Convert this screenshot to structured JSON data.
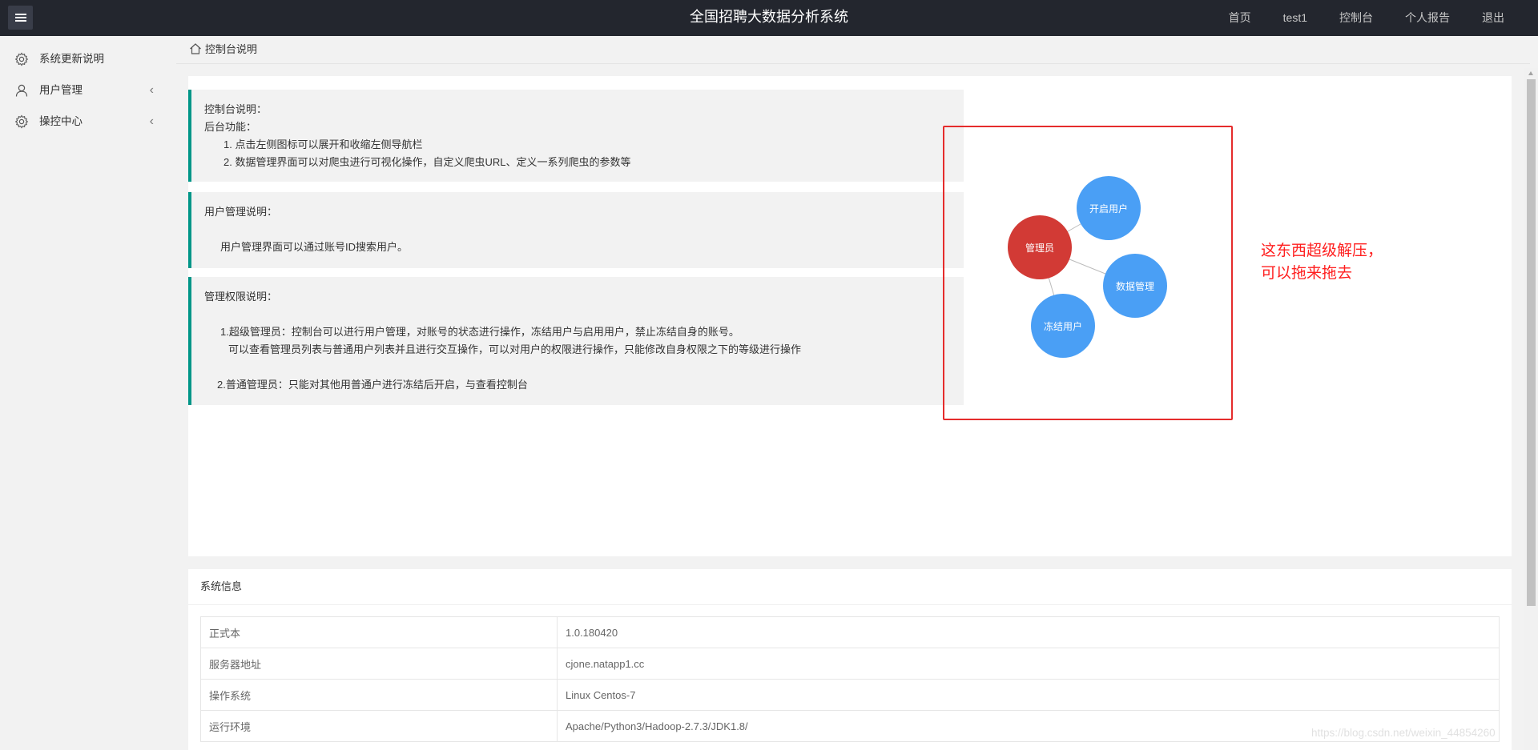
{
  "header": {
    "title": "全国招聘大数据分析系统",
    "nav": [
      "首页",
      "test1",
      "控制台",
      "个人报告",
      "退出"
    ]
  },
  "sidebar": {
    "items": [
      {
        "label": "系统更新说明",
        "icon": "gear-icon",
        "expandable": false
      },
      {
        "label": "用户管理",
        "icon": "user-icon",
        "expandable": true
      },
      {
        "label": "操控中心",
        "icon": "gear-icon",
        "expandable": true
      }
    ]
  },
  "breadcrumb": {
    "label": "控制台说明"
  },
  "notes": {
    "console": {
      "title": "控制台说明：",
      "subtitle": "后台功能：",
      "items": [
        "1. 点击左侧图标可以展开和收缩左侧导航栏",
        "2. 数据管理界面可以对爬虫进行可视化操作，自定义爬虫URL、定义一系列爬虫的参数等"
      ]
    },
    "user_mgmt": {
      "title": "用户管理说明：",
      "body": "用户管理界面可以通过账号ID搜索用户。"
    },
    "permissions": {
      "title": "管理权限说明：",
      "line1": "1.超级管理员：控制台可以进行用户管理，对账号的状态进行操作，冻结用户与启用用户，禁止冻结自身的账号。",
      "line2": "可以查看管理员列表与普通用户列表并且进行交互操作，可以对用户的权限进行操作，只能修改自身权限之下的等级进行操作",
      "line3": "2.普通管理员：只能对其他用普通户进行冻结后开启，与查看控制台"
    }
  },
  "graph": {
    "nodes": [
      {
        "label": "管理员",
        "color": "#d23a35"
      },
      {
        "label": "开启用户",
        "color": "#4a9ff5"
      },
      {
        "label": "数据管理",
        "color": "#4a9ff5"
      },
      {
        "label": "冻结用户",
        "color": "#4a9ff5"
      }
    ],
    "annotation_line1": "这东西超级解压，",
    "annotation_line2": "可以拖来拖去",
    "frame_color": "#e52c2c"
  },
  "system_info": {
    "title": "系统信息",
    "rows": [
      {
        "key": "正式本",
        "value": "1.0.180420"
      },
      {
        "key": "服务器地址",
        "value": "cjone.natapp1.cc"
      },
      {
        "key": "操作系统",
        "value": "Linux Centos-7"
      },
      {
        "key": "运行环境",
        "value": "Apache/Python3/Hadoop-2.7.3/JDK1.8/"
      }
    ]
  },
  "watermark": "https://blog.csdn.net/weixin_44854260",
  "colors": {
    "accent": "#009688",
    "topbar": "#23262e",
    "admin_node": "#d23a35",
    "node": "#4a9ff5"
  }
}
